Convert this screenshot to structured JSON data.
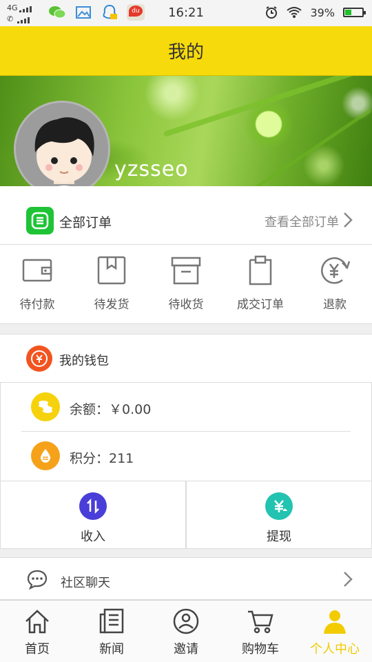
{
  "status_bar": {
    "network": "4G",
    "time": "16:21",
    "battery_percent": "39%",
    "battery_level": 0.39,
    "notification_icons": [
      "wechat-icon",
      "gallery-icon",
      "qq-icon",
      "baidu-map-icon"
    ],
    "baidu_badge": "du"
  },
  "header": {
    "title": "我的"
  },
  "profile": {
    "username": "yzsseo"
  },
  "orders": {
    "title": "全部订单",
    "view_all": "查看全部订单",
    "items": [
      {
        "label": "待付款",
        "icon": "wallet-icon"
      },
      {
        "label": "待发货",
        "icon": "box-icon"
      },
      {
        "label": "待收货",
        "icon": "archive-box-icon"
      },
      {
        "label": "成交订单",
        "icon": "clipboard-icon"
      },
      {
        "label": "退款",
        "icon": "yen-refund-icon"
      }
    ]
  },
  "wallet": {
    "title": "我的钱包",
    "balance_label": "余额：￥0.00",
    "points_label": "积分：211",
    "actions": [
      {
        "label": "收入",
        "icon": "transfer-arrows-icon",
        "color": "#4a3ed8"
      },
      {
        "label": "提现",
        "icon": "yen-withdraw-icon",
        "color": "#22c3b0"
      }
    ],
    "colors": {
      "wallet_icon": "#f2541f",
      "balance_coin": "#f6d20c",
      "points_coin": "#f5a21a"
    }
  },
  "community": {
    "label": "社区聊天"
  },
  "tabbar": {
    "tabs": [
      {
        "label": "首页",
        "icon": "home-icon",
        "active": false
      },
      {
        "label": "新闻",
        "icon": "news-icon",
        "active": false
      },
      {
        "label": "邀请",
        "icon": "invite-icon",
        "active": false
      },
      {
        "label": "购物车",
        "icon": "cart-icon",
        "active": false
      },
      {
        "label": "个人中心",
        "icon": "person-icon",
        "active": true
      }
    ],
    "active_color": "#f2cb00"
  },
  "theme": {
    "header_bg": "#f6da0b",
    "orders_icon_bg": "#1ec435"
  }
}
